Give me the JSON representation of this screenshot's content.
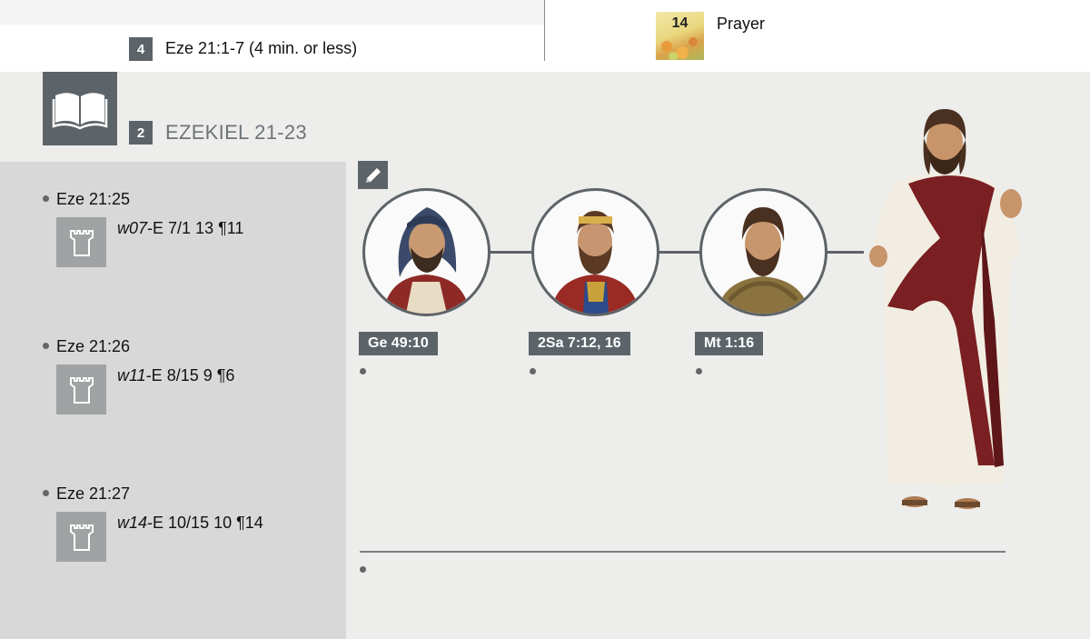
{
  "top": {
    "assignment_number": "4",
    "assignment_text": "Eze 21:1-7 (4 min. or less)",
    "song_number": "14",
    "prayer_label": "Prayer"
  },
  "section": {
    "number": "2",
    "title": "EZEKIEL 21-23"
  },
  "references": [
    {
      "scripture": "Eze 21:25",
      "pub_italic": "w07",
      "pub_rest": "-E 7/1 13 ¶11"
    },
    {
      "scripture": "Eze 21:26",
      "pub_italic": "w11",
      "pub_rest": "-E 8/15 9 ¶6"
    },
    {
      "scripture": "Eze 21:27",
      "pub_italic": "w14",
      "pub_rest": "-E 10/15 10 ¶14"
    }
  ],
  "lineage": [
    {
      "label": "Ge 49:10"
    },
    {
      "label": "2Sa 7:12, 16"
    },
    {
      "label": "Mt 1:16"
    }
  ],
  "icons": [
    "book-icon",
    "pencil-icon",
    "watchtower-icon"
  ],
  "colors": {
    "badge": "#5c6469",
    "sidebar": "#d7d8d7",
    "robe": "#7a1f22"
  }
}
